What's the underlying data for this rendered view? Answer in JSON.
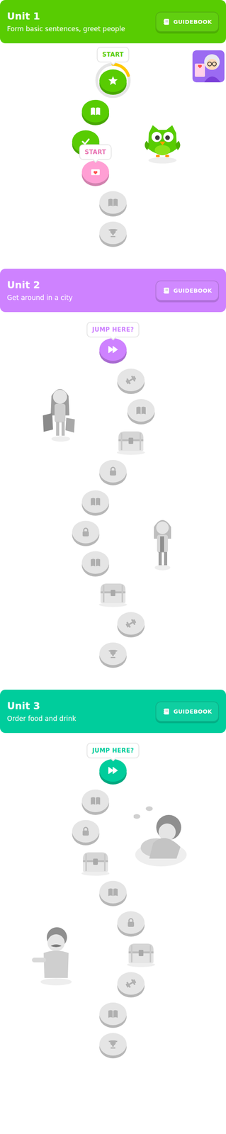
{
  "units": [
    {
      "title": "Unit 1",
      "subtitle": "Form basic sentences, greet people",
      "guidebook": "GUIDEBOOK",
      "color": "#58cc02",
      "nodes": [
        {
          "kind": "star",
          "locked": false,
          "tooltip": "START",
          "level": 0.2
        },
        {
          "kind": "book",
          "locked": false
        },
        {
          "kind": "check",
          "locked": false
        },
        {
          "kind": "story",
          "locked": false,
          "tooltip": "START"
        },
        {
          "kind": "book",
          "locked": true
        },
        {
          "kind": "trophy",
          "locked": true
        }
      ]
    },
    {
      "title": "Unit 2",
      "subtitle": "Get around in a city",
      "guidebook": "GUIDEBOOK",
      "color": "#ce82ff",
      "nodes": [
        {
          "kind": "jump",
          "locked": false,
          "tooltip": "JUMP HERE?"
        },
        {
          "kind": "practice",
          "locked": true
        },
        {
          "kind": "book",
          "locked": true
        },
        {
          "kind": "chest",
          "locked": true
        },
        {
          "kind": "lock",
          "locked": true
        },
        {
          "kind": "book",
          "locked": true
        },
        {
          "kind": "lock",
          "locked": true
        },
        {
          "kind": "book",
          "locked": true
        },
        {
          "kind": "chest",
          "locked": true
        },
        {
          "kind": "practice",
          "locked": true
        },
        {
          "kind": "trophy",
          "locked": true
        }
      ]
    },
    {
      "title": "Unit 3",
      "subtitle": "Order food and drink",
      "guidebook": "GUIDEBOOK",
      "color": "#00cd9c",
      "nodes": [
        {
          "kind": "jump",
          "locked": false,
          "tooltip": "JUMP HERE?"
        },
        {
          "kind": "book",
          "locked": true
        },
        {
          "kind": "lock",
          "locked": true
        },
        {
          "kind": "chest",
          "locked": true
        },
        {
          "kind": "book",
          "locked": true
        },
        {
          "kind": "lock",
          "locked": true
        },
        {
          "kind": "chest",
          "locked": true
        },
        {
          "kind": "practice",
          "locked": true
        },
        {
          "kind": "book",
          "locked": true
        },
        {
          "kind": "trophy",
          "locked": true
        }
      ]
    }
  ]
}
